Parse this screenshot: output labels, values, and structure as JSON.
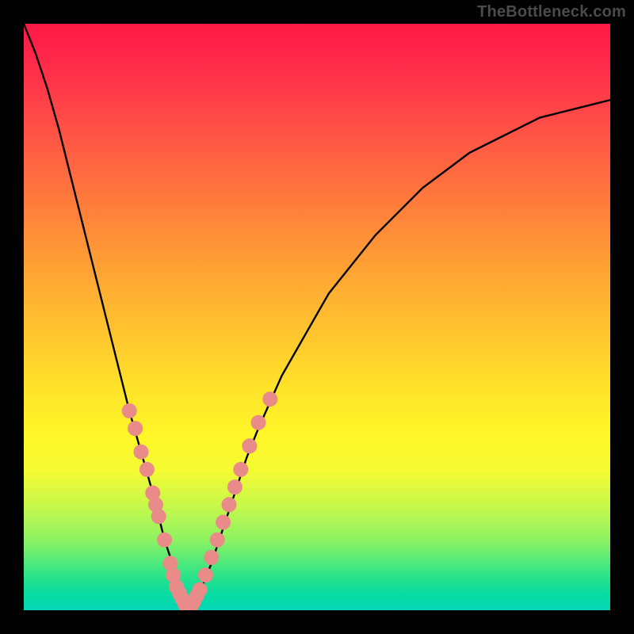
{
  "watermark": "TheBottleneck.com",
  "colors": {
    "curve": "#000000",
    "marker_fill": "#e98b88",
    "marker_stroke": "#e98b88"
  },
  "chart_data": {
    "type": "line",
    "title": "",
    "xlabel": "",
    "ylabel": "",
    "xlim": [
      0,
      100
    ],
    "ylim": [
      0,
      100
    ],
    "x": [
      0,
      2,
      4,
      6,
      8,
      10,
      12,
      14,
      16,
      18,
      20,
      22,
      24,
      26,
      27,
      28,
      30,
      32,
      34,
      36,
      38,
      40,
      44,
      48,
      52,
      56,
      60,
      64,
      68,
      72,
      76,
      80,
      84,
      88,
      92,
      96,
      100
    ],
    "y": [
      100,
      95,
      89,
      82,
      74,
      66,
      58,
      50,
      42,
      34,
      27,
      20,
      12,
      6,
      2,
      0,
      3,
      8,
      14,
      20,
      26,
      31,
      40,
      47,
      54,
      59,
      64,
      68,
      72,
      75,
      78,
      80,
      82,
      84,
      85,
      86,
      87
    ],
    "marker_points": [
      {
        "x": 18,
        "y": 34
      },
      {
        "x": 19,
        "y": 31
      },
      {
        "x": 20,
        "y": 27
      },
      {
        "x": 21,
        "y": 24
      },
      {
        "x": 22,
        "y": 20
      },
      {
        "x": 22.5,
        "y": 18
      },
      {
        "x": 23,
        "y": 16
      },
      {
        "x": 24,
        "y": 12
      },
      {
        "x": 25,
        "y": 8
      },
      {
        "x": 25.5,
        "y": 6
      },
      {
        "x": 26,
        "y": 4
      },
      {
        "x": 26.5,
        "y": 3
      },
      {
        "x": 27,
        "y": 2
      },
      {
        "x": 27.5,
        "y": 1
      },
      {
        "x": 28,
        "y": 0
      },
      {
        "x": 28.5,
        "y": 0.5
      },
      {
        "x": 29,
        "y": 1.5
      },
      {
        "x": 29.5,
        "y": 2.5
      },
      {
        "x": 30,
        "y": 3.5
      },
      {
        "x": 31,
        "y": 6
      },
      {
        "x": 32,
        "y": 9
      },
      {
        "x": 33,
        "y": 12
      },
      {
        "x": 34,
        "y": 15
      },
      {
        "x": 35,
        "y": 18
      },
      {
        "x": 36,
        "y": 21
      },
      {
        "x": 37,
        "y": 24
      },
      {
        "x": 38.5,
        "y": 28
      },
      {
        "x": 40,
        "y": 32
      },
      {
        "x": 42,
        "y": 36
      }
    ],
    "marker_radius": 9
  }
}
